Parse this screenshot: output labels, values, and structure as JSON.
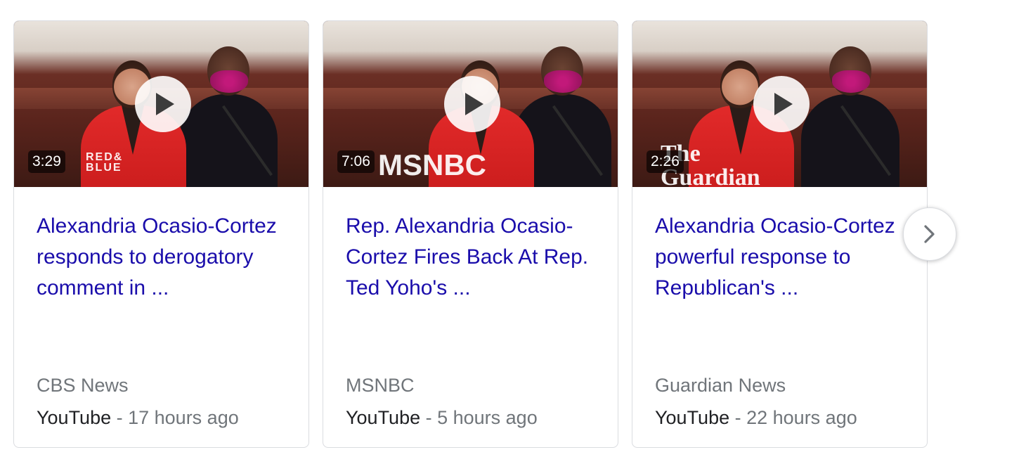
{
  "videos": [
    {
      "duration": "3:29",
      "channel_logo": "RED&\nBLUE",
      "title": "Alexandria Ocasio-Cortez responds to derogatory comment in ...",
      "source": "CBS News",
      "platform": "YouTube",
      "separator": " - ",
      "age": "17 hours ago"
    },
    {
      "duration": "7:06",
      "channel_logo": "MSNBC",
      "title": "Rep. Alexandria Ocasio-Cortez Fires Back At Rep. Ted Yoho's ...",
      "source": "MSNBC",
      "platform": "YouTube",
      "separator": " - ",
      "age": "5 hours ago"
    },
    {
      "duration": "2:26",
      "channel_logo": "The Guardian",
      "title": "Alexandria Ocasio-Cortez powerful response to Republican's ...",
      "source": "Guardian News",
      "platform": "YouTube",
      "separator": " - ",
      "age": "22 hours ago"
    }
  ],
  "icons": {
    "play": "play-icon",
    "next": "chevron-right-icon"
  },
  "colors": {
    "title_link": "#1a0dab",
    "meta_text": "#70757a",
    "platform_text": "#202124",
    "card_border": "#dadce0"
  }
}
